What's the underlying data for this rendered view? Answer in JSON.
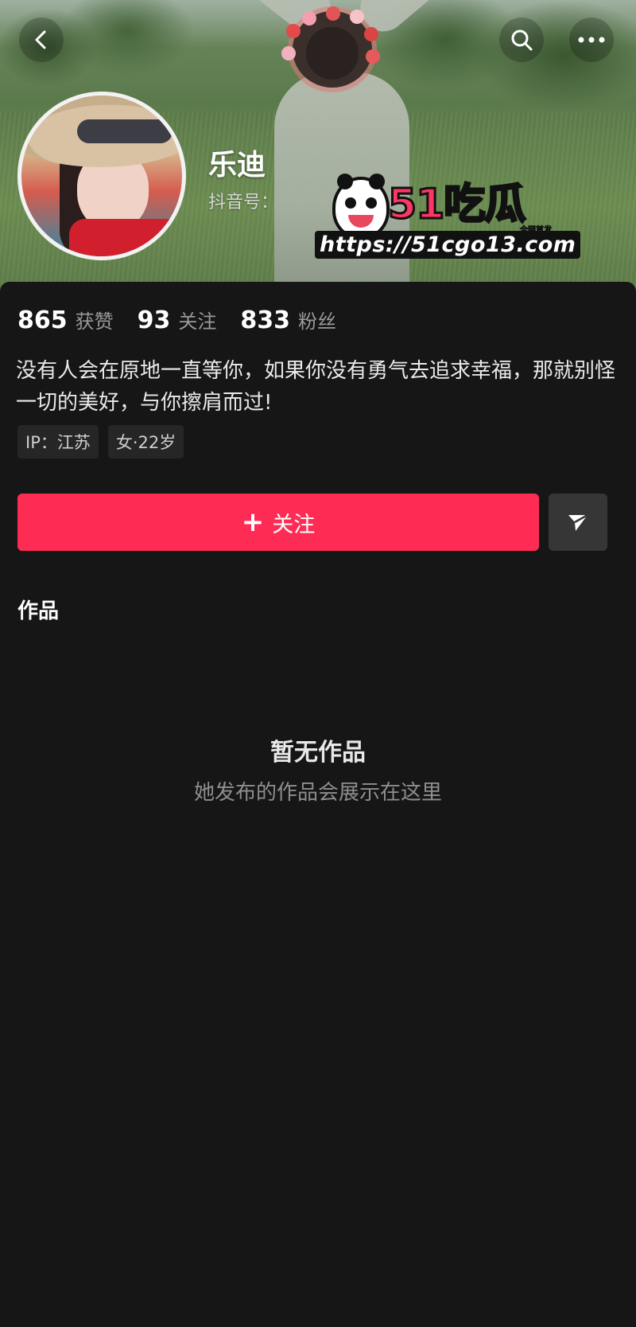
{
  "header": {
    "display_name": "乐迪",
    "account_id_label": "抖音号："
  },
  "watermark": {
    "logo_text": "51吃瓜",
    "tagline": "全网首发",
    "url": "https://51cgo13.com"
  },
  "stats": [
    {
      "value": "865",
      "label": "获赞"
    },
    {
      "value": "93",
      "label": "关注"
    },
    {
      "value": "833",
      "label": "粉丝"
    }
  ],
  "bio": "没有人会在原地一直等你，如果你没有勇气去追求幸福，那就别怪一切的美好，与你擦肩而过!",
  "tags": [
    "IP：江苏",
    "女·22岁"
  ],
  "actions": {
    "follow_label": "关注",
    "follow_icon": "plus-icon",
    "share_icon": "send-icon"
  },
  "works": {
    "section_title": "作品",
    "empty_title": "暂无作品",
    "empty_subtitle": "她发布的作品会展示在这里"
  },
  "colors": {
    "accent": "#fe2c55",
    "background": "#161616",
    "secondary_button": "#363636"
  }
}
